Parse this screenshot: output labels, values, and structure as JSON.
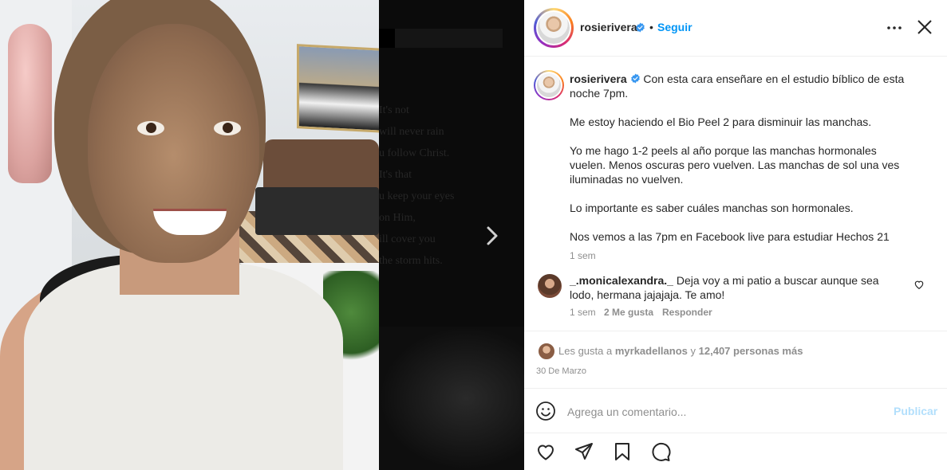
{
  "post": {
    "username": "rosierivera",
    "follow_label": "Seguir",
    "dot": "•"
  },
  "caption": {
    "username": "rosierivera",
    "paragraphs": [
      "Con esta cara enseñare en el estudio bíblico de esta noche 7pm.",
      "Me estoy haciendo el Bio Peel 2 para disminuir las manchas.",
      "Yo me hago 1-2 peels al año porque las manchas hormonales vuelen. Menos oscuras pero vuelven. Las manchas de sol una ves iluminadas no vuelven.",
      "Lo importante es saber cuáles manchas son hormonales.",
      "Nos vemos a las 7pm en Facebook live para estudiar Hechos 21"
    ],
    "time": "1 sem"
  },
  "comment": {
    "username": "_.monicalexandra._",
    "text": "Deja voy a mi patio a buscar aunque sea lodo, hermana jajajaja. Te amo!",
    "time": "1 sem",
    "likes": "2 Me gusta",
    "reply": "Responder"
  },
  "likes": {
    "prefix": "Les gusta a",
    "user": "myrkadellanos",
    "connector": "y",
    "count": "12,407 personas más"
  },
  "date": "30 De Marzo",
  "comment_box": {
    "placeholder": "Agrega un comentario...",
    "publish_label": "Publicar"
  },
  "background_text": "It's not\nwill never rain\nu follow Christ.\nIt's that\nu keep your eyes\non Him,\nill cover you\nthe storm hits.",
  "colors": {
    "accent": "#0095f6",
    "publish_disabled": "#b2dffc",
    "muted": "#8e8e8e",
    "text": "#262626"
  },
  "icons": [
    "more-icon",
    "close-icon",
    "verified-icon",
    "chevron-right-icon",
    "heart-icon",
    "share-icon",
    "bookmark-icon",
    "comment-icon",
    "emoji-icon"
  ]
}
